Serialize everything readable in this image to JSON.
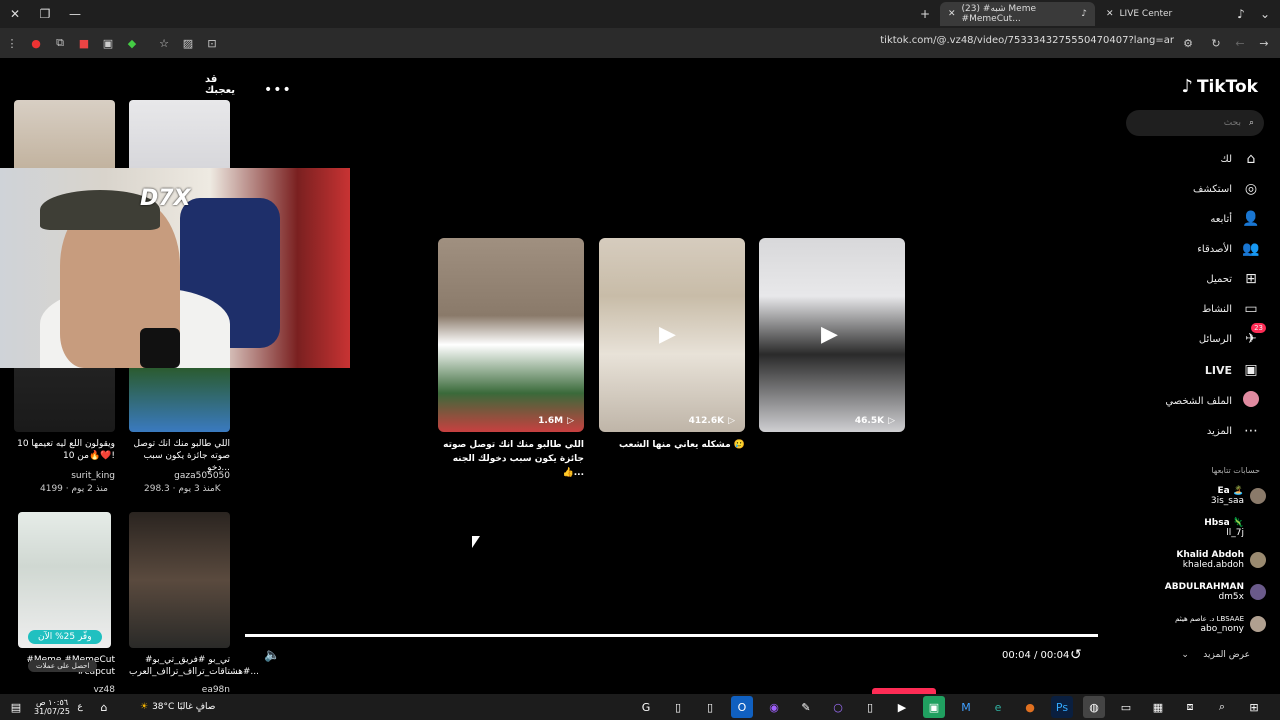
{
  "browser": {
    "tabs": [
      {
        "label": "LIVE Center",
        "active": false
      },
      {
        "label": "(23) #شبه Meme #MemeCut...",
        "active": true
      }
    ],
    "url": "tiktok.com/@.vz48/video/7533343275550470407?lang=ar"
  },
  "sidebar": {
    "logo": "TikTok",
    "search_placeholder": "بحث",
    "items": [
      {
        "label": "لك",
        "icon": "home-icon"
      },
      {
        "label": "استكشف",
        "icon": "compass-icon"
      },
      {
        "label": "أتابعه",
        "icon": "following-icon"
      },
      {
        "label": "الأصدقاء",
        "icon": "friends-icon"
      },
      {
        "label": "تحميل",
        "icon": "upload-icon"
      },
      {
        "label": "النشاط",
        "icon": "activity-icon"
      },
      {
        "label": "الرسائل",
        "icon": "messages-icon",
        "badge": "23"
      },
      {
        "label": "LIVE",
        "icon": "live-icon"
      },
      {
        "label": "الملف الشخصي",
        "icon": "profile-icon"
      },
      {
        "label": "المزيد",
        "icon": "more-icon"
      }
    ],
    "following_heading": "حسابات تتابعها",
    "following": [
      {
        "name": "Ea 🏝️",
        "handle": "3is_saa"
      },
      {
        "name": "Hbsa 🦎",
        "handle": "ll_7j"
      },
      {
        "name": "Khalid Abdoh",
        "handle": "khaled.abdoh"
      },
      {
        "name": "ABDULRAHMAN",
        "handle": "dm5x"
      },
      {
        "name": "د. عاصم هيثم LBSAAE",
        "handle": "abo_nony"
      }
    ],
    "see_more": "عرض المزيد"
  },
  "left": {
    "suggest_heading": "قد يعجبك",
    "items": [
      {
        "caption": "ويقولون اللع ليه تعيمها 10 من 10🔥❤️!",
        "author": "surit_king",
        "meta": "منذ 2 يوم · 4199"
      },
      {
        "caption": "اللي طالبو منك انك توصل صوته جائزة يكون سبب دخو...",
        "author": "gaza505050",
        "meta": "منذ 3 يوم · 298.3K"
      },
      {
        "caption": "#Meme #MemeCut #capcut",
        "author": "vz48",
        "meta": ""
      },
      {
        "caption": "#تي_بو #فريق_تي_بو #هشتاقات_ترااف_ترااف_العرب...",
        "author": "ea98n",
        "meta": ""
      }
    ],
    "promo": "وفّر 25% الآن",
    "promo2": "احصل على عملات"
  },
  "videos": [
    {
      "count": "1.6M",
      "title": "اللي طالبو منك انك توصل صوته جائزة يكون سبب دخولك الجنه 👍..."
    },
    {
      "count": "412.6K",
      "title": "مشكله يعاني منها الشعب 🥲"
    },
    {
      "count": "46.5K",
      "title": ""
    }
  ],
  "player": {
    "time": "00:04 / 00:04",
    "progress": 1.0
  },
  "webcam_logo": "D7X",
  "taskbar": {
    "weather": "38°C صافٍ غالبًا",
    "time": "١٠:٥٦ ص",
    "date": "31/07/25",
    "lang": "ع"
  }
}
